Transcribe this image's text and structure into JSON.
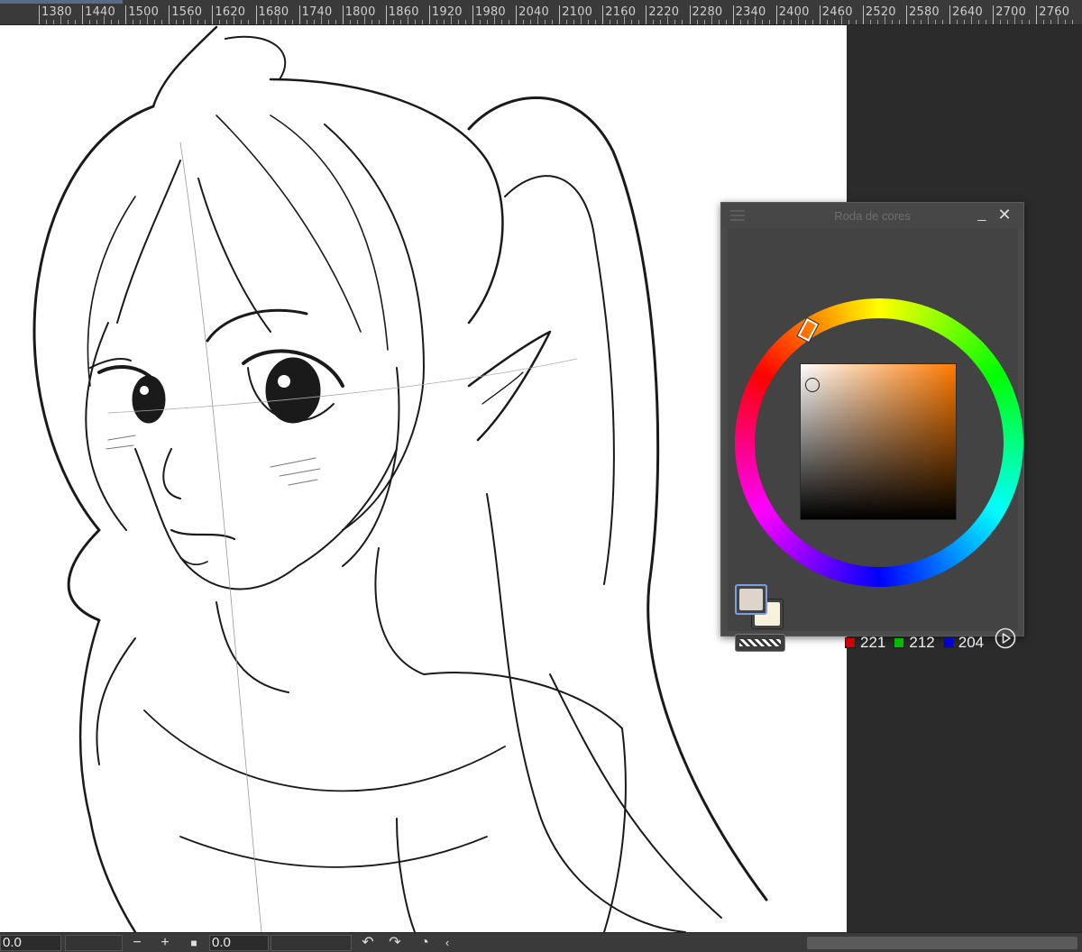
{
  "ruler": {
    "labels": [
      "1380",
      "1440",
      "1500",
      "1560",
      "1620",
      "1680",
      "1740",
      "1800",
      "1860",
      "1920",
      "1980",
      "2040",
      "2100",
      "2160",
      "2220",
      "2280",
      "2340",
      "2400",
      "2460",
      "2520",
      "2580",
      "2640",
      "2700",
      "2760"
    ]
  },
  "panel": {
    "title": "Roda de cores",
    "minimize_icon": "minimize-icon",
    "close_icon": "close-icon",
    "menu_icon": "menu-icon"
  },
  "color": {
    "foreground_hex": "#ddd4cc",
    "background_hex": "#f8f2dc",
    "hue_hex": "#ff7a00",
    "r": "221",
    "g": "212",
    "b": "204",
    "r_chip": "#cc0000",
    "g_chip": "#00bb00",
    "b_chip": "#0000dd"
  },
  "bottom": {
    "left_value": "0.0",
    "minus": "−",
    "plus": "+",
    "angle_value": "0.0"
  }
}
